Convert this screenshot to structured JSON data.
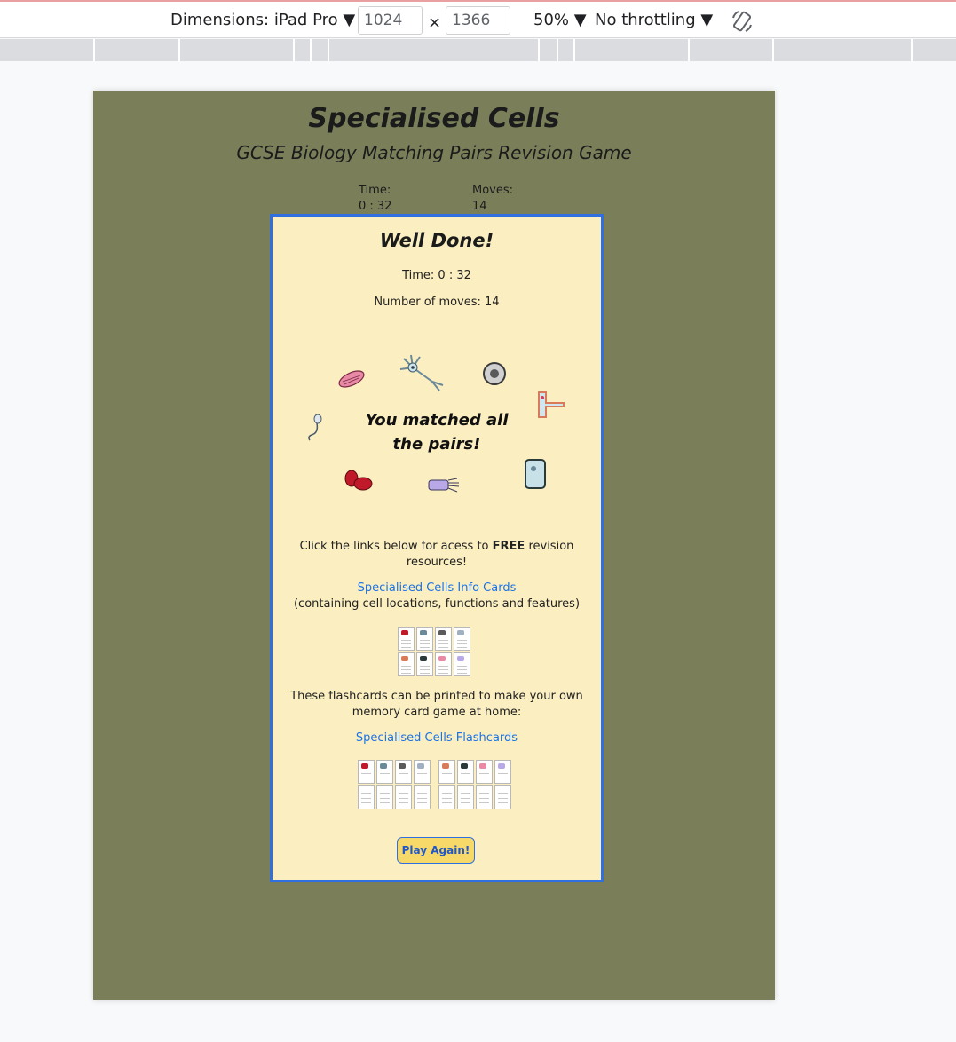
{
  "devtools": {
    "device_label": "Dimensions: iPad Pro",
    "width_value": "1024",
    "height_value": "1366",
    "times": "×",
    "zoom": "50%",
    "throttling": "No throttling"
  },
  "game": {
    "title": "Specialised Cells",
    "subtitle": "GCSE Biology Matching Pairs Revision Game",
    "time_label": "Time:",
    "time_value": "0 : 32",
    "moves_label": "Moves:",
    "moves_value": "14"
  },
  "modal": {
    "title": "Well Done!",
    "time_text": "Time: 0 : 32",
    "moves_text": "Number of moves: 14",
    "matched_text": "You matched all the pairs!",
    "links_intro_a": "Click the links below for acess to ",
    "links_intro_bold": "FREE",
    "links_intro_b": " revision resources!",
    "info_cards_link": "Specialised Cells Info Cards",
    "info_cards_note": "(containing cell locations, functions and features)",
    "flashcards_intro": "These flashcards can be printed to make your own memory card game at home:",
    "flashcards_link": "Specialised Cells Flashcards",
    "play_again": "Play Again!"
  },
  "cell_icons": [
    "muscle-cell-icon",
    "nerve-cell-icon",
    "egg-cell-icon",
    "root-hair-cell-icon",
    "sperm-cell-icon",
    "red-blood-cell-icon",
    "ciliated-cell-icon",
    "palisade-cell-icon"
  ],
  "colors": {
    "page_bg": "#7a7f5a",
    "modal_bg": "#fbeec0",
    "modal_border": "#2f6fe0",
    "link": "#1a73e8",
    "button_bg": "#f7d96a"
  }
}
